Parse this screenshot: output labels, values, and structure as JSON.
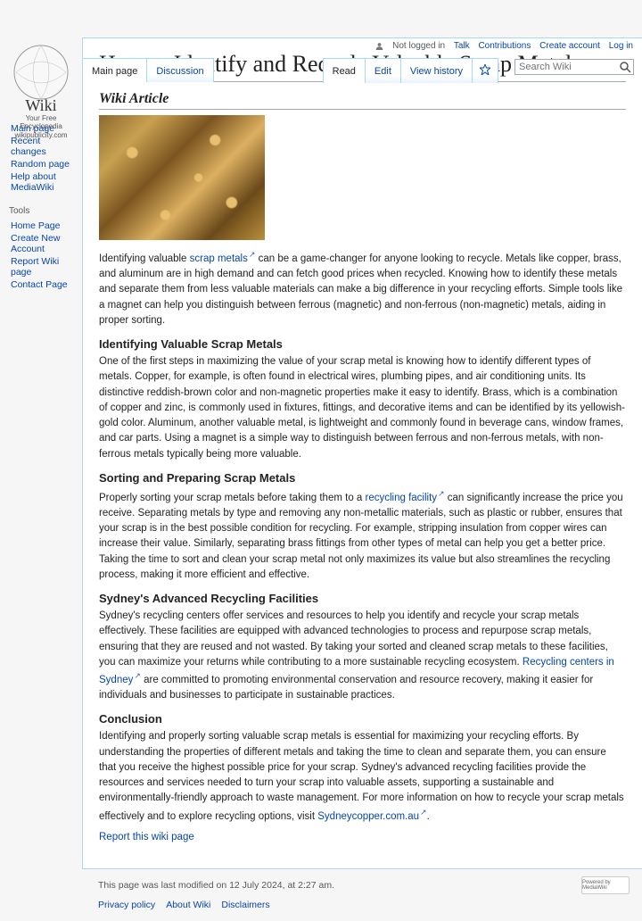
{
  "logo": {
    "title": "Wiki",
    "sub": "Your Free Encyclopedia",
    "domain": "wikipublicity.com"
  },
  "nav_main": [
    "Main page",
    "Recent changes",
    "Random page",
    "Help about MediaWiki"
  ],
  "tools_heading": "Tools",
  "nav_tools": [
    "Home Page",
    "Create New Account",
    "Report Wiki page",
    "Contact Page"
  ],
  "topbar": {
    "notlogged": "Not logged in",
    "talk": "Talk",
    "contribs": "Contributions",
    "create": "Create account",
    "login": "Log in"
  },
  "tabs_left": [
    {
      "label": "Main page",
      "active": true
    },
    {
      "label": "Discussion",
      "active": false
    }
  ],
  "tabs_right": [
    {
      "label": "Read",
      "active": true
    },
    {
      "label": "Edit",
      "active": false
    },
    {
      "label": "View history",
      "active": false
    }
  ],
  "search": {
    "placeholder": "Search Wiki"
  },
  "title": "How to Identify and Recycle Valuable Scrap Metals",
  "section_wiki": "Wiki Article",
  "intro": {
    "t1": "Identifying valuable ",
    "link1": "scrap metals",
    "t2": " can be a game-changer for anyone looking to recycle. Metals like copper, brass, and aluminum are in high demand and can fetch good prices when recycled. Knowing how to identify these metals and separate them from less valuable materials can make a big difference in your recycling efforts. Simple tools like a magnet can help you distinguish between ferrous (magnetic) and non-ferrous (non-magnetic) metals, aiding in proper sorting."
  },
  "s1": {
    "h": "Identifying Valuable Scrap Metals",
    "p": "One of the first steps in maximizing the value of your scrap metal is knowing how to identify different types of metals. Copper, for example, is often found in electrical wires, plumbing pipes, and air conditioning units. Its distinctive reddish-brown color and non-magnetic properties make it easy to identify. Brass, which is a combination of copper and zinc, is commonly used in fixtures, fittings, and decorative items and can be identified by its yellowish-gold color. Aluminum, another valuable metal, is lightweight and commonly found in beverage cans, window frames, and car parts. Using a magnet is a simple way to distinguish between ferrous and non-ferrous metals, with non-ferrous metals typically being more valuable."
  },
  "s2": {
    "h": "Sorting and Preparing Scrap Metals",
    "t1": "Properly sorting your scrap metals before taking them to a ",
    "link": "recycling facility",
    "t2": " can significantly increase the price you receive. Separating metals by type and removing any non-metallic materials, such as plastic or rubber, ensures that your scrap is in the best possible condition for recycling. For example, stripping insulation from copper wires can increase their value. Similarly, separating brass fittings from other types of metal can help you get a better price. Taking the time to sort and clean your scrap metal not only maximizes its value but also streamlines the recycling process, making it more efficient and effective."
  },
  "s3": {
    "h": "Sydney's Advanced Recycling Facilities",
    "t1": "Sydney's recycling centers offer services and resources to help you identify and recycle your scrap metals effectively. These facilities are equipped with advanced technologies to process and repurpose scrap metals, ensuring that they are reused and not wasted. By taking your sorted and cleaned scrap metals to these facilities, you can maximize your returns while contributing to a more sustainable recycling ecosystem. ",
    "link": "Recycling centers in Sydney",
    "t2": " are committed to promoting environmental conservation and resource recovery, making it easier for individuals and businesses to participate in sustainable practices."
  },
  "s4": {
    "h": "Conclusion",
    "t1": "Identifying and properly sorting valuable scrap metals is essential for maximizing your recycling efforts. By understanding the properties of different metals and taking the time to clean and separate them, you can ensure that you receive the highest possible price for your scrap. Sydney's advanced recycling facilities provide the resources and services needed to turn your scrap into valuable assets, supporting a sustainable and environmentally-friendly approach to waste management. For more information on how to recycle your scrap metals effectively and to explore recycling options, visit ",
    "link": "Sydneycopper.com.au",
    "t2": "."
  },
  "report_link": "Report this wiki page",
  "footer": {
    "modified": "This page was last modified on 12 July 2024, at 2:27 am.",
    "links": [
      "Privacy policy",
      "About Wiki",
      "Disclaimers"
    ],
    "powered": "Powered by MediaWiki"
  }
}
